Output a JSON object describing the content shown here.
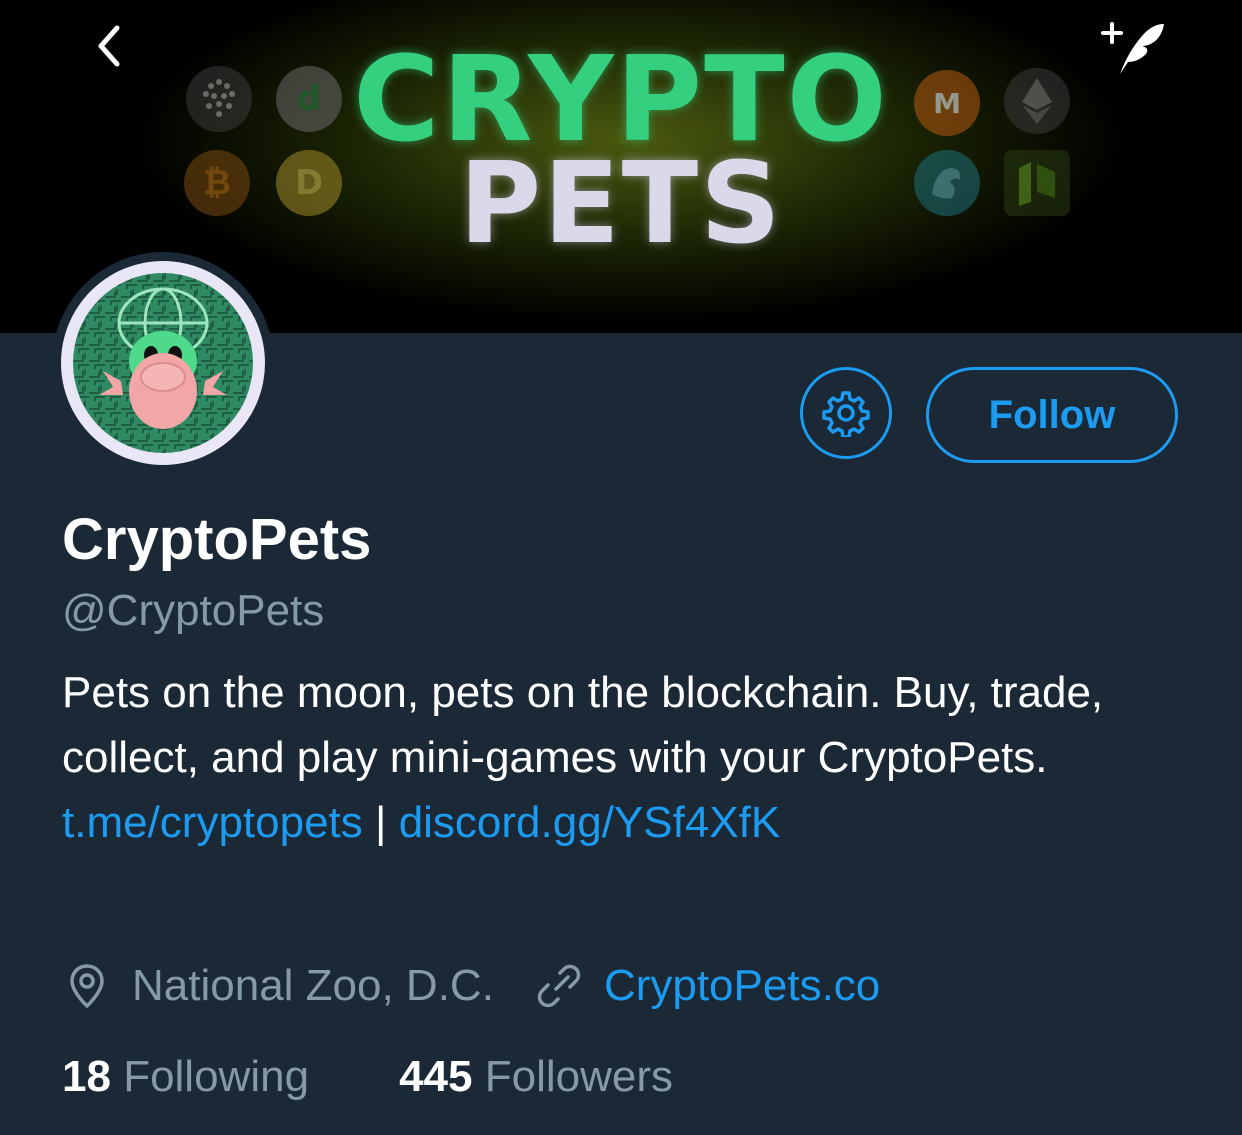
{
  "banner": {
    "line1": "CRYPTO",
    "line2": "PETS",
    "colors": {
      "line1": "#35d07f",
      "line2": "#d9d9ea"
    },
    "coin_icons": [
      "iota-coin-icon",
      "digibyte-coin-icon",
      "bitcoin-coin-icon",
      "dogecoin-coin-icon",
      "monero-coin-icon",
      "ethereum-coin-icon",
      "dragon-coin-icon",
      "neo-coin-icon"
    ]
  },
  "nav": {
    "back_icon": "chevron-left-icon",
    "compose_icon": "compose-tweet-icon"
  },
  "profile": {
    "display_name": "CryptoPets",
    "handle": "@CryptoPets",
    "bio_text": "Pets on the moon, pets on the blockchain. Buy, trade, collect, and play mini-games with your CryptoPets.",
    "bio_link1": "t.me/cryptopets",
    "bio_separator": "|",
    "bio_link2": "discord.gg/YSf4XfK",
    "location": "National Zoo, D.C.",
    "website": "CryptoPets.co"
  },
  "actions": {
    "settings_icon": "gear-icon",
    "follow_label": "Follow"
  },
  "stats": {
    "following_count": "18",
    "following_label": "Following",
    "followers_count": "445",
    "followers_label": "Followers"
  },
  "colors": {
    "background": "#1b2836",
    "accent": "#1d9bf0",
    "secondary_text": "#8899a6"
  }
}
